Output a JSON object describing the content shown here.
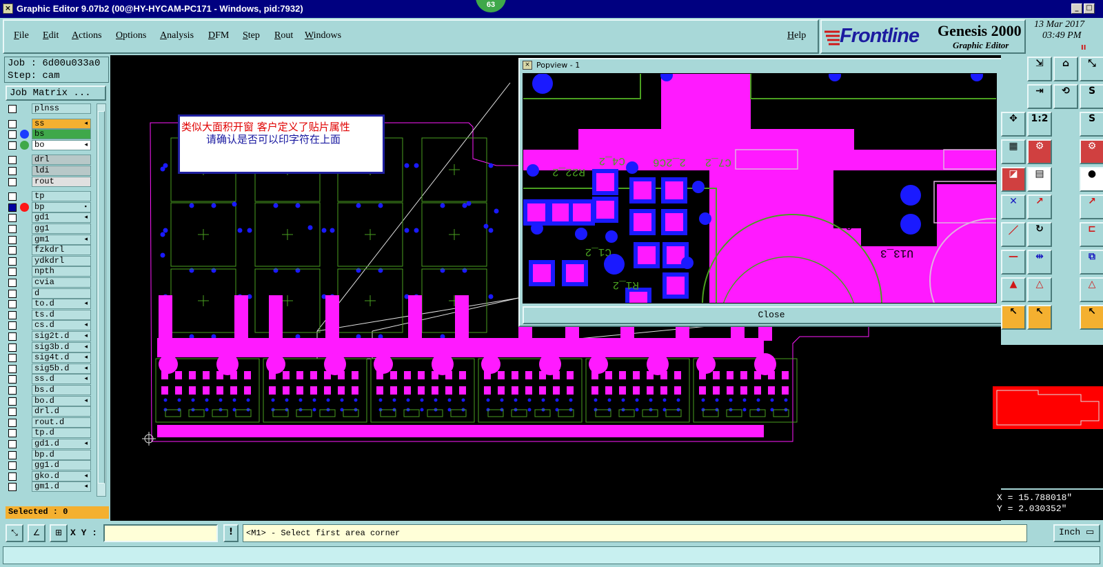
{
  "window": {
    "title": "Graphic Editor 9.07b2 (00@HY-HYCAM-PC171 - Windows, pid:7932)",
    "badge": "63",
    "min_label": "_",
    "max_label": "□",
    "close_label": "✕"
  },
  "menu": {
    "items": [
      "File",
      "Edit",
      "Actions",
      "Options",
      "Analysis",
      "DFM",
      "Step",
      "Rout",
      "Windows"
    ],
    "help": "Help"
  },
  "branding": {
    "logo": "Frontline",
    "product": "Genesis 2000",
    "subtitle": "Graphic Editor",
    "date": "13 Mar 2017",
    "time": "03:49 PM",
    "mark": "II"
  },
  "job": {
    "job_line": "Job : 6d00u033a0",
    "step_line": "Step: cam",
    "matrix_button": "Job Matrix ..."
  },
  "layers": [
    {
      "name": "plnss",
      "color": "#b8e0e0",
      "dot": "",
      "mark": ""
    },
    {
      "name": "ss",
      "color": "#f4b030",
      "dot": "",
      "mark": "◂"
    },
    {
      "name": "bs",
      "color": "#3fa84a",
      "dot": "#1a3cff",
      "mark": ""
    },
    {
      "name": "bo",
      "color": "#ffffff",
      "dot": "#3fa84a",
      "mark": "◂"
    },
    {
      "name": "drl",
      "color": "#b8c8c8",
      "dot": "",
      "mark": ""
    },
    {
      "name": "ldi",
      "color": "#b8c8c8",
      "dot": "",
      "mark": ""
    },
    {
      "name": "rout",
      "color": "#e0e0e0",
      "dot": "",
      "mark": ""
    },
    {
      "name": "tp",
      "color": "#b8e0e0",
      "dot": "",
      "mark": ""
    },
    {
      "name": "bp",
      "color": "#b8e0e0",
      "dot": "#ff1818",
      "mark": "▪",
      "checked": true
    },
    {
      "name": "gd1",
      "color": "#b8e0e0",
      "dot": "",
      "mark": "◂"
    },
    {
      "name": "gg1",
      "color": "#b8e0e0",
      "dot": "",
      "mark": ""
    },
    {
      "name": "gm1",
      "color": "#b8e0e0",
      "dot": "",
      "mark": "◂"
    },
    {
      "name": "fzkdrl",
      "color": "#b8e0e0",
      "dot": "",
      "mark": ""
    },
    {
      "name": "ydkdrl",
      "color": "#b8e0e0",
      "dot": "",
      "mark": ""
    },
    {
      "name": "npth",
      "color": "#b8e0e0",
      "dot": "",
      "mark": ""
    },
    {
      "name": "cvia",
      "color": "#b8e0e0",
      "dot": "",
      "mark": ""
    },
    {
      "name": "d",
      "color": "#b8e0e0",
      "dot": "",
      "mark": ""
    },
    {
      "name": "to.d",
      "color": "#b8e0e0",
      "dot": "",
      "mark": "◂"
    },
    {
      "name": "ts.d",
      "color": "#b8e0e0",
      "dot": "",
      "mark": ""
    },
    {
      "name": "cs.d",
      "color": "#b8e0e0",
      "dot": "",
      "mark": "◂"
    },
    {
      "name": "sig2t.d",
      "color": "#b8e0e0",
      "dot": "",
      "mark": "◂"
    },
    {
      "name": "sig3b.d",
      "color": "#b8e0e0",
      "dot": "",
      "mark": "◂"
    },
    {
      "name": "sig4t.d",
      "color": "#b8e0e0",
      "dot": "",
      "mark": "◂"
    },
    {
      "name": "sig5b.d",
      "color": "#b8e0e0",
      "dot": "",
      "mark": "◂"
    },
    {
      "name": "ss.d",
      "color": "#b8e0e0",
      "dot": "",
      "mark": "◂"
    },
    {
      "name": "bs.d",
      "color": "#b8e0e0",
      "dot": "",
      "mark": ""
    },
    {
      "name": "bo.d",
      "color": "#b8e0e0",
      "dot": "",
      "mark": "◂"
    },
    {
      "name": "drl.d",
      "color": "#b8e0e0",
      "dot": "",
      "mark": ""
    },
    {
      "name": "rout.d",
      "color": "#b8e0e0",
      "dot": "",
      "mark": ""
    },
    {
      "name": "tp.d",
      "color": "#b8e0e0",
      "dot": "",
      "mark": ""
    },
    {
      "name": "gd1.d",
      "color": "#b8e0e0",
      "dot": "",
      "mark": "◂"
    },
    {
      "name": "bp.d",
      "color": "#b8e0e0",
      "dot": "",
      "mark": ""
    },
    {
      "name": "gg1.d",
      "color": "#b8e0e0",
      "dot": "",
      "mark": ""
    },
    {
      "name": "gko.d",
      "color": "#b8e0e0",
      "dot": "",
      "mark": "◂"
    },
    {
      "name": "gm1.d",
      "color": "#b8e0e0",
      "dot": "",
      "mark": "◂"
    }
  ],
  "selected": "Selected : 0",
  "note": {
    "line1": "类似大面积开窗  客户定义了贴片属性",
    "line2": "请确认是否可以印字符在上面"
  },
  "popview": {
    "title": "Popview - 1",
    "close_x": "✕",
    "close_button": "Close",
    "labels": [
      "C4_2",
      "R22_2",
      "2_2C6",
      "C7_2",
      "R30_3",
      "L1_2",
      "U13_3",
      "C1_2",
      "R1_2",
      "C3",
      "2"
    ]
  },
  "coords": {
    "x": "X = 15.788018\"",
    "y": "Y = 2.030352\""
  },
  "bottom": {
    "xy_label": "X Y :",
    "xy_value": "",
    "warn": "!",
    "prompt": "<M1> - Select first area corner",
    "units": "Inch ▭"
  },
  "colors": {
    "panel": "#a8d8d8",
    "magenta": "#ff1aff",
    "trace_green": "#4aa020",
    "pad_blue": "#1a1aff",
    "orange": "#f4b030"
  }
}
